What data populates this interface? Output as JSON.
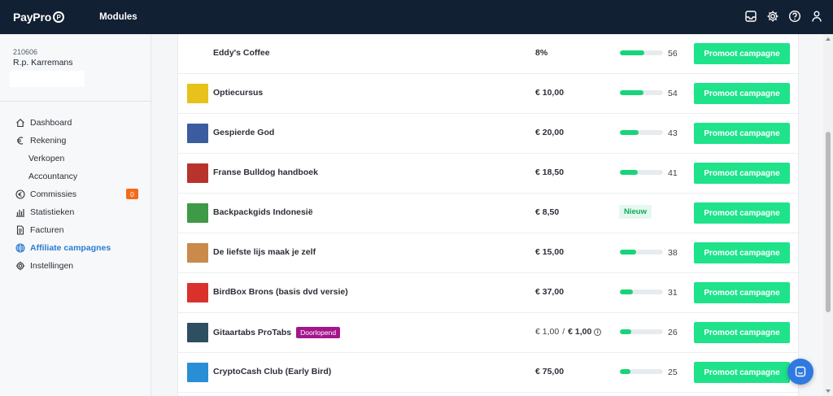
{
  "header": {
    "logo_text": "PayPro",
    "modules_label": "Modules",
    "icons": [
      "inbox-icon",
      "gear-icon",
      "help-icon",
      "user-icon"
    ]
  },
  "sidebar": {
    "account_id": "210606",
    "account_name": "R.p. Karremans",
    "items": [
      {
        "label": "Dashboard",
        "icon": "home-icon"
      },
      {
        "label": "Rekening",
        "icon": "euro-icon"
      },
      {
        "label": "Verkopen"
      },
      {
        "label": "Accountancy"
      },
      {
        "label": "Commissies",
        "icon": "euro-circle-icon",
        "badge": "0"
      },
      {
        "label": "Statistieken",
        "icon": "chart-icon"
      },
      {
        "label": "Facturen",
        "icon": "file-icon"
      },
      {
        "label": "Affiliate campagnes",
        "icon": "globe-icon",
        "active": true
      },
      {
        "label": "Instellingen",
        "icon": "gear-icon"
      }
    ]
  },
  "campaigns": [
    {
      "name": "Eddy's Coffee",
      "price": "8%",
      "score": "56",
      "score_pct": 56,
      "button": "Promoot campagne",
      "thumb_color": "#ffffff"
    },
    {
      "name": "Optiecursus",
      "price": "€ 10,00",
      "score": "54",
      "score_pct": 54,
      "button": "Promoot campagne",
      "thumb_color": "#e6c21a"
    },
    {
      "name": "Gespierde God",
      "price": "€ 20,00",
      "score": "43",
      "score_pct": 43,
      "button": "Promoot campagne",
      "thumb_color": "#3b5c9e"
    },
    {
      "name": "Franse Bulldog handboek",
      "price": "€ 18,50",
      "score": "41",
      "score_pct": 41,
      "button": "Promoot campagne",
      "thumb_color": "#b8332b"
    },
    {
      "name": "Backpackgids Indonesië",
      "price": "€ 8,50",
      "badge": "Nieuw",
      "button": "Promoot campagne",
      "thumb_color": "#3e9a46"
    },
    {
      "name": "De liefste lijs maak je zelf",
      "price": "€ 15,00",
      "score": "38",
      "score_pct": 38,
      "button": "Promoot campagne",
      "thumb_color": "#c98a4b"
    },
    {
      "name": "BirdBox Brons (basis dvd versie)",
      "price": "€ 37,00",
      "score": "31",
      "score_pct": 31,
      "button": "Promoot campagne",
      "thumb_color": "#d9312b"
    },
    {
      "name": "Gitaartabs ProTabs",
      "tag": "Doorlopend",
      "price_old": "€ 1,00",
      "price_sep": "/",
      "price": "€ 1,00",
      "score": "26",
      "score_pct": 26,
      "button": "Promoot campagne",
      "thumb_color": "#2e4f5f"
    },
    {
      "name": "CryptoCash Club (Early Bird)",
      "price": "€ 75,00",
      "score": "25",
      "score_pct": 25,
      "button": "Promoot campagne",
      "thumb_color": "#2a8ed6"
    }
  ],
  "colors": {
    "topbar": "#122033",
    "accent_green": "#1ee38a",
    "active_blue": "#2b7cd3",
    "badge_orange": "#f36b1c",
    "tag_purple": "#a3168c"
  }
}
